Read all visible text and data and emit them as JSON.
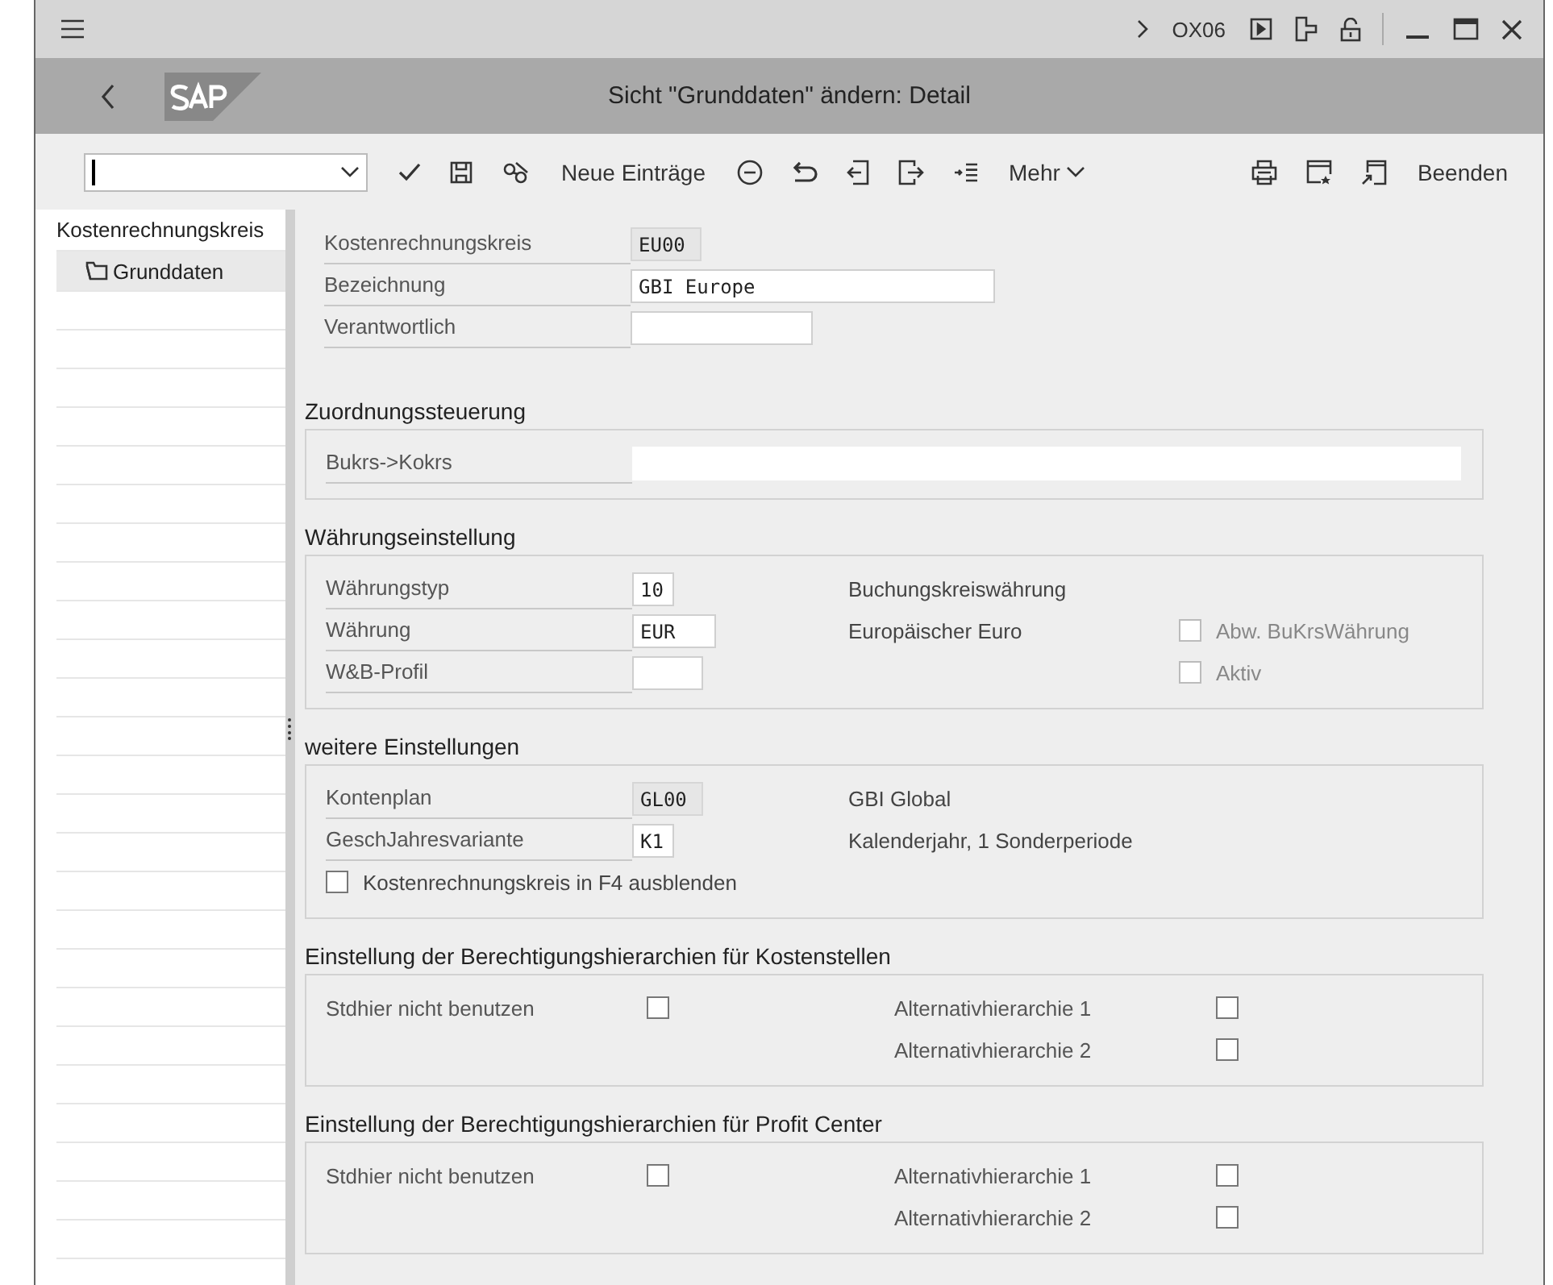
{
  "top_bar": {
    "transaction": "OX06"
  },
  "title_bar": {
    "title": "Sicht \"Grunddaten\" ändern: Detail"
  },
  "toolbar": {
    "new_entries_button": "Neue Einträge",
    "more_menu": "Mehr",
    "exit_button": "Beenden"
  },
  "sidebar": {
    "header": "Kostenrechnungskreis",
    "items": [
      {
        "label": "Grunddaten",
        "selected": true
      }
    ]
  },
  "header_fields": [
    {
      "label": "Kostenrechnungskreis",
      "value": "EU00",
      "editable": false
    },
    {
      "label": "Bezeichnung",
      "value": "GBI Europe",
      "editable": true
    },
    {
      "label": "Verantwortlich",
      "editable": true
    }
  ],
  "sections": [
    {
      "title": "Zuordnungssteuerung",
      "kind": "fields",
      "rows": [
        {
          "label": "Bukrs->Kokrs",
          "editable": true
        }
      ]
    },
    {
      "title": "Währungseinstellung",
      "kind": "fields",
      "rows": [
        {
          "label": "Währungstyp",
          "value": "10",
          "editable": true,
          "description": "Buchungskreiswährung"
        },
        {
          "label": "Währung",
          "value": "EUR",
          "editable": true,
          "description": "Europäischer Euro",
          "checkbox": {
            "label": "Abw. BuKrsWährung",
            "checked": false,
            "disabled": true
          }
        },
        {
          "label": "W&B-Profil",
          "editable": true,
          "checkbox": {
            "label": "Aktiv",
            "checked": false,
            "disabled": true
          }
        }
      ]
    },
    {
      "title": "weitere Einstellungen",
      "kind": "fields",
      "rows": [
        {
          "label": "Kontenplan",
          "value": "GL00",
          "editable": false,
          "description": "GBI Global"
        },
        {
          "label": "GeschJahresvariante",
          "value": "K1",
          "editable": true,
          "description": "Kalenderjahr, 1 Sonderperiode"
        }
      ],
      "checkboxes": [
        {
          "label": "Kostenrechnungskreis in F4 ausblenden",
          "checked": false,
          "disabled": false
        }
      ]
    },
    {
      "title": "Einstellung der Berechtigungshierarchien für Kostenstellen",
      "kind": "checkgrid",
      "left": [
        {
          "label": "Stdhier nicht benutzen",
          "checked": false
        }
      ],
      "right": [
        {
          "label": "Alternativhierarchie 1",
          "checked": false
        },
        {
          "label": "Alternativhierarchie 2",
          "checked": false
        }
      ]
    },
    {
      "title": "Einstellung der Berechtigungshierarchien für Profit Center",
      "kind": "checkgrid",
      "left": [
        {
          "label": "Stdhier nicht benutzen",
          "checked": false
        }
      ],
      "right": [
        {
          "label": "Alternativhierarchie 1",
          "checked": false
        },
        {
          "label": "Alternativhierarchie 2",
          "checked": false
        }
      ]
    }
  ]
}
